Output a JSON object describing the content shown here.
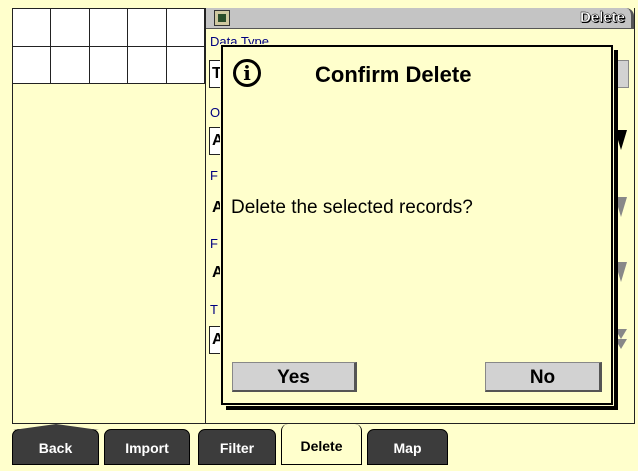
{
  "window": {
    "title": "Delete"
  },
  "form": {
    "data_type_label": "Data Type",
    "field1_value": "T",
    "label_o": "O",
    "field2_value": "A",
    "label_f1": "F",
    "field3_value": "A",
    "label_f2": "F",
    "field4_value": "A",
    "label_t": "T",
    "field5_value": "A"
  },
  "dialog": {
    "title": "Confirm Delete",
    "info_icon": "info-icon",
    "message": "Delete the selected records?",
    "yes_label": "Yes",
    "no_label": "No"
  },
  "tabs": [
    {
      "label": "Back"
    },
    {
      "label": "Import"
    },
    {
      "label": "Filter"
    },
    {
      "label": "Delete",
      "active": true
    },
    {
      "label": "Map"
    }
  ],
  "colors": {
    "background": "#ffffcc",
    "tab": "#3c3c3c",
    "button": "#d2d2d2",
    "label": "#000080"
  }
}
